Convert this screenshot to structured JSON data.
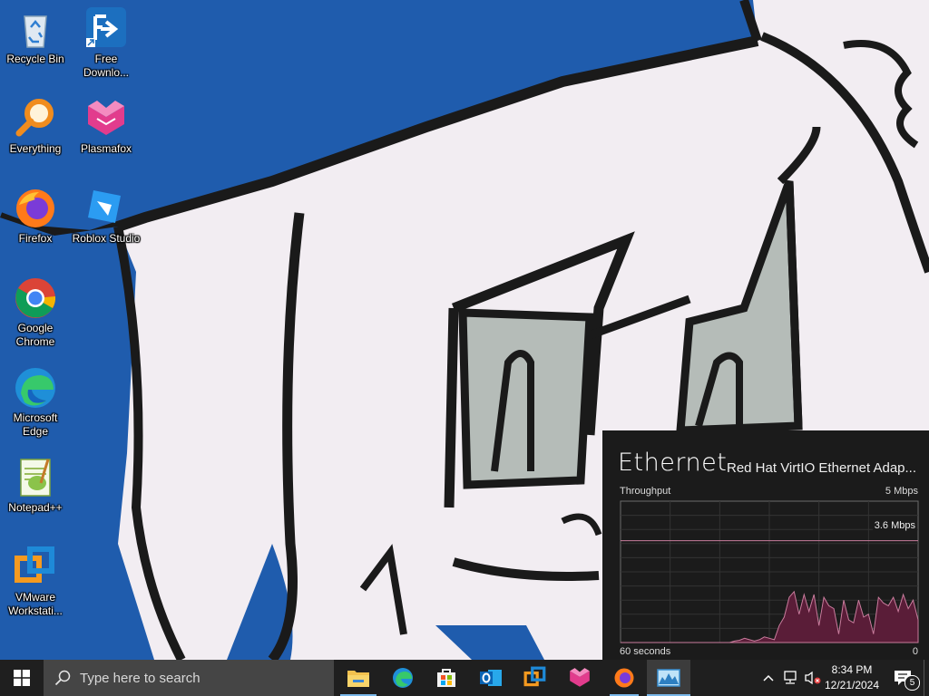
{
  "desktop": {
    "icons": [
      {
        "label": "Recycle Bin",
        "icon": "recycle-bin-icon"
      },
      {
        "label": "Free\nDownlo...",
        "icon": "free-download-manager-icon"
      },
      {
        "label": "Everything",
        "icon": "everything-search-icon"
      },
      {
        "label": "Plasmafox",
        "icon": "plasmafox-icon"
      },
      {
        "label": "Firefox",
        "icon": "firefox-icon"
      },
      {
        "label": "Roblox Studio",
        "icon": "roblox-studio-icon"
      },
      {
        "label": "Google\nChrome",
        "icon": "chrome-icon"
      },
      {
        "label": "Microsoft\nEdge",
        "icon": "edge-icon"
      },
      {
        "label": "Notepad++",
        "icon": "notepadpp-icon"
      },
      {
        "label": "VMware\nWorkstati...",
        "icon": "vmware-icon"
      }
    ]
  },
  "network_widget": {
    "title": "Ethernet",
    "adapter": "Red Hat VirtIO Ethernet Adap...",
    "throughput_label": "Throughput",
    "max_label": "5 Mbps",
    "peak_label": "3.6 Mbps",
    "time_label": "60 seconds",
    "min_label": "0",
    "colors": {
      "line": "#c97c9d",
      "fill": "#5a1d38",
      "bg": "#1b1b1b"
    }
  },
  "chart_data": {
    "type": "area",
    "title": "Ethernet",
    "ylabel": "Throughput",
    "xlabel": "60 seconds",
    "ylim": [
      0,
      5
    ],
    "peak_line": 3.6,
    "series": [
      {
        "values": [
          0,
          0,
          0,
          0,
          0,
          0,
          0,
          0,
          0,
          0,
          0,
          0,
          0,
          0,
          0,
          0,
          0,
          0,
          0,
          0,
          0,
          0,
          0,
          0.05,
          0.08,
          0.15,
          0.1,
          0.05,
          0.1,
          0.2,
          0.15,
          0.1,
          0.6,
          0.9,
          1.6,
          1.8,
          1.0,
          1.7,
          1.1,
          1.7,
          0.6,
          1.6,
          1.3,
          1.2,
          0.3,
          1.5,
          0.8,
          0.7,
          1.5,
          0.9,
          1.0,
          0.3,
          1.6,
          1.4,
          1.3,
          1.6,
          1.1,
          1.7,
          1.2,
          1.5,
          0.8
        ]
      }
    ]
  },
  "taskbar": {
    "search_placeholder": "Type here to search",
    "apps": [
      "file-explorer-icon",
      "edge-icon",
      "store-icon",
      "outlook-icon",
      "vmware-icon",
      "plasmafox-icon",
      "firefox-icon",
      "resource-monitor-icon"
    ],
    "time": "8:34 PM",
    "date": "12/21/2024",
    "notification_count": "5"
  }
}
